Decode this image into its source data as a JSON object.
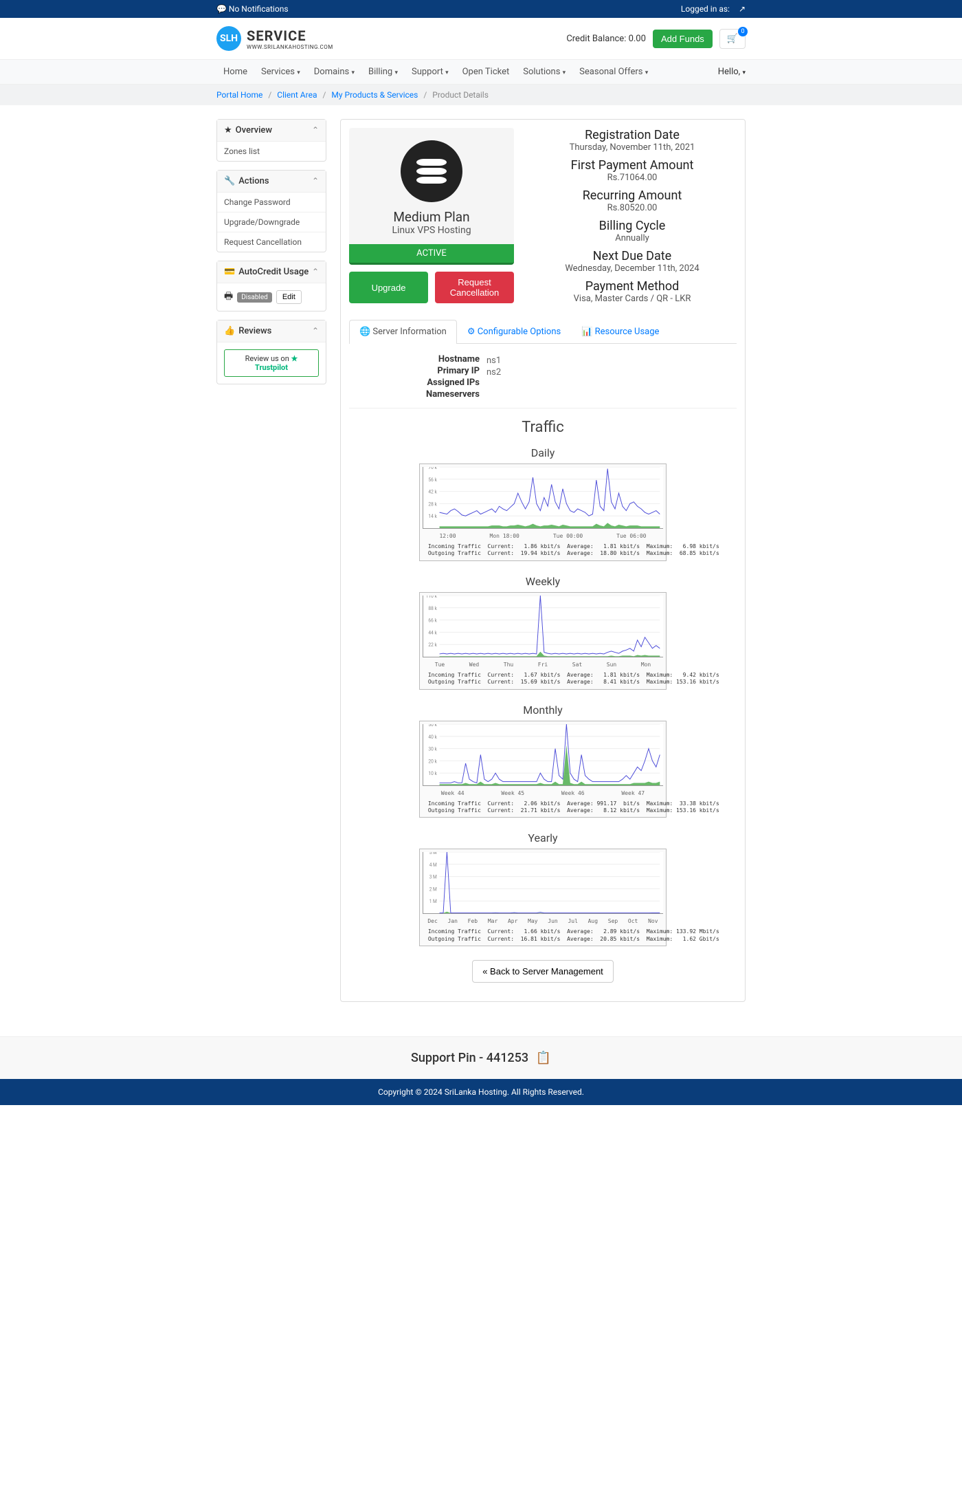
{
  "topbar": {
    "notifications": "No Notifications",
    "logged_in": "Logged in as:",
    "user": "        "
  },
  "header": {
    "logo_main": "SERVICE",
    "logo_sub": "WWW.SRILANKAHOSTING.COM",
    "logo_badge": "SLH",
    "credit_label": "Credit Balance: 0.00",
    "add_funds": "Add Funds",
    "cart_count": "0"
  },
  "nav": {
    "items": [
      "Home",
      "Services",
      "Domains",
      "Billing",
      "Support",
      "Open Ticket",
      "Solutions",
      "Seasonal Offers"
    ],
    "dropdowns": [
      false,
      true,
      true,
      true,
      true,
      false,
      true,
      true
    ],
    "hello": "Hello,",
    "hello_user": "  "
  },
  "breadcrumb": {
    "portal": "Portal Home",
    "client": "Client Area",
    "products": "My Products & Services",
    "current": "Product Details"
  },
  "sidebar": {
    "overview": {
      "title": "Overview",
      "items": [
        "Zones list"
      ]
    },
    "actions": {
      "title": "Actions",
      "items": [
        "Change Password",
        "Upgrade/Downgrade",
        "Request Cancellation"
      ]
    },
    "autocredit": {
      "title": "AutoCredit Usage",
      "status": "Disabled",
      "edit": "Edit"
    },
    "reviews": {
      "title": "Reviews",
      "trustpilot": "Review us on ★ Trustpilot"
    }
  },
  "product": {
    "plan": "Medium Plan",
    "subtitle": "Linux VPS Hosting",
    "status": "ACTIVE",
    "upgrade": "Upgrade",
    "cancel": "Request Cancellation",
    "info": [
      {
        "label": "Registration Date",
        "value": "Thursday, November 11th, 2021"
      },
      {
        "label": "First Payment Amount",
        "value": "Rs.71064.00"
      },
      {
        "label": "Recurring Amount",
        "value": "Rs.80520.00"
      },
      {
        "label": "Billing Cycle",
        "value": "Annually"
      },
      {
        "label": "Next Due Date",
        "value": "Wednesday, December 11th, 2024"
      },
      {
        "label": "Payment Method",
        "value": "Visa, Master Cards / QR - LKR"
      }
    ]
  },
  "tabs": {
    "server": "Server Information",
    "config": "Configurable Options",
    "resource": "Resource Usage"
  },
  "server": {
    "hostname_label": "Hostname",
    "hostname": "           ",
    "ip_label": "Primary IP",
    "ip": "           ",
    "assigned_label": "Assigned IPs",
    "assigned": "                                           ",
    "ns_label": "Nameservers",
    "ns1": "ns1",
    "ns2": "ns2"
  },
  "traffic": {
    "title": "Traffic",
    "charts": [
      "Daily",
      "Weekly",
      "Monthly",
      "Yearly"
    ]
  },
  "chart_data": [
    {
      "type": "line",
      "title": "Daily",
      "ylim": [
        0,
        70
      ],
      "yunit": "k",
      "ticks": [
        "12:00",
        "Mon 18:00",
        "Tue 00:00",
        "Tue 06:00"
      ],
      "series": [
        {
          "name": "Incoming Traffic",
          "color": "#2a9d2a",
          "stats": {
            "Current": "1.86 kbit/s",
            "Average": "1.81 kbit/s",
            "Maximum": "6.98 kbit/s"
          }
        },
        {
          "name": "Outgoing Traffic",
          "color": "#4a4ad8",
          "stats": {
            "Current": "19.94 kbit/s",
            "Average": "18.80 kbit/s",
            "Maximum": "68.85 kbit/s"
          }
        }
      ],
      "out_values": [
        18,
        17,
        16,
        20,
        22,
        19,
        15,
        14,
        16,
        18,
        20,
        16,
        18,
        20,
        22,
        18,
        25,
        22,
        20,
        24,
        28,
        40,
        30,
        22,
        30,
        58,
        28,
        20,
        35,
        25,
        50,
        30,
        22,
        45,
        28,
        20,
        18,
        22,
        20,
        18,
        14,
        16,
        55,
        25,
        20,
        68,
        30,
        22,
        40,
        25,
        20,
        28,
        30,
        25,
        22,
        18,
        16,
        18,
        20,
        16
      ],
      "in_values": [
        2,
        2,
        2,
        2,
        2,
        2,
        2,
        2,
        2,
        2,
        2,
        2,
        2,
        2,
        3,
        3,
        3,
        2,
        2,
        3,
        3,
        4,
        3,
        2,
        3,
        5,
        3,
        2,
        3,
        3,
        4,
        3,
        2,
        4,
        3,
        2,
        2,
        2,
        2,
        2,
        2,
        2,
        5,
        3,
        2,
        6,
        3,
        2,
        4,
        3,
        2,
        3,
        3,
        3,
        2,
        2,
        2,
        2,
        2,
        2
      ]
    },
    {
      "type": "line",
      "title": "Weekly",
      "ylim": [
        0,
        110
      ],
      "yunit": "k",
      "ticks": [
        "Tue",
        "Wed",
        "Thu",
        "Fri",
        "Sat",
        "Sun",
        "Mon"
      ],
      "series": [
        {
          "name": "Incoming Traffic",
          "color": "#2a9d2a",
          "stats": {
            "Current": "1.67 kbit/s",
            "Average": "1.81 kbit/s",
            "Maximum": "9.42 kbit/s"
          }
        },
        {
          "name": "Outgoing Traffic",
          "color": "#4a4ad8",
          "stats": {
            "Current": "15.69 kbit/s",
            "Average": "8.41 kbit/s",
            "Maximum": "153.16 kbit/s"
          }
        }
      ],
      "out_values": [
        5,
        6,
        5,
        6,
        5,
        6,
        5,
        6,
        5,
        6,
        5,
        6,
        5,
        6,
        5,
        6,
        5,
        6,
        5,
        6,
        5,
        6,
        5,
        6,
        5,
        6,
        5,
        110,
        8,
        6,
        5,
        6,
        5,
        6,
        5,
        6,
        5,
        6,
        5,
        6,
        5,
        6,
        5,
        6,
        5,
        8,
        10,
        8,
        6,
        10,
        12,
        15,
        10,
        30,
        18,
        35,
        25,
        15,
        20,
        15
      ],
      "in_values": [
        1,
        1,
        1,
        1,
        1,
        1,
        1,
        1,
        1,
        1,
        1,
        1,
        1,
        1,
        1,
        1,
        1,
        1,
        1,
        1,
        1,
        1,
        1,
        1,
        1,
        1,
        1,
        9,
        2,
        1,
        1,
        1,
        1,
        1,
        1,
        1,
        1,
        1,
        1,
        1,
        1,
        1,
        1,
        1,
        1,
        1,
        2,
        1,
        1,
        2,
        2,
        2,
        1,
        3,
        2,
        3,
        2,
        2,
        2,
        2
      ]
    },
    {
      "type": "line",
      "title": "Monthly",
      "ylim": [
        0,
        50
      ],
      "yunit": "k",
      "ticks": [
        "Week 44",
        "Week 45",
        "Week 46",
        "Week 47"
      ],
      "series": [
        {
          "name": "Incoming Traffic",
          "color": "#2a9d2a",
          "stats": {
            "Current": "2.06 kbit/s",
            "Average": "991.17  bit/s",
            "Maximum": "33.38 kbit/s"
          }
        },
        {
          "name": "Outgoing Traffic",
          "color": "#4a4ad8",
          "stats": {
            "Current": "21.71 kbit/s",
            "Average": "8.12 kbit/s",
            "Maximum": "153.16 kbit/s"
          }
        }
      ],
      "out_values": [
        2,
        2,
        2,
        2,
        3,
        2,
        2,
        18,
        5,
        3,
        2,
        25,
        5,
        3,
        5,
        10,
        5,
        3,
        3,
        3,
        3,
        3,
        3,
        3,
        3,
        3,
        3,
        10,
        5,
        3,
        3,
        30,
        8,
        5,
        50,
        10,
        5,
        3,
        25,
        8,
        5,
        3,
        3,
        3,
        3,
        3,
        3,
        3,
        3,
        5,
        8,
        5,
        10,
        15,
        12,
        20,
        30,
        20,
        15,
        25
      ],
      "in_values": [
        1,
        1,
        1,
        1,
        1,
        1,
        1,
        2,
        1,
        1,
        1,
        3,
        1,
        1,
        1,
        2,
        1,
        1,
        1,
        1,
        1,
        1,
        1,
        1,
        1,
        1,
        1,
        2,
        1,
        1,
        1,
        3,
        1,
        1,
        33,
        2,
        1,
        1,
        3,
        1,
        1,
        1,
        1,
        1,
        1,
        1,
        1,
        1,
        1,
        1,
        1,
        1,
        2,
        2,
        2,
        2,
        3,
        2,
        2,
        3
      ]
    },
    {
      "type": "line",
      "title": "Yearly",
      "ylim": [
        0,
        5
      ],
      "yunit": "M",
      "ticks": [
        "Dec",
        "Jan",
        "Feb",
        "Mar",
        "Apr",
        "May",
        "Jun",
        "Jul",
        "Aug",
        "Sep",
        "Oct",
        "Nov"
      ],
      "series": [
        {
          "name": "Incoming Traffic",
          "color": "#2a9d2a",
          "stats": {
            "Current": "1.66 kbit/s",
            "Average": "2.89 kbit/s",
            "Maximum": "133.92 Mbit/s"
          }
        },
        {
          "name": "Outgoing Traffic",
          "color": "#4a4ad8",
          "stats": {
            "Current": "16.81 kbit/s",
            "Average": "20.85 kbit/s",
            "Maximum": "1.62 Gbit/s"
          }
        }
      ],
      "out_values": [
        0.02,
        0.02,
        5,
        0.02,
        0.02,
        0.02,
        0.02,
        0.02,
        0.02,
        0.02,
        0.02,
        0.02,
        0.02,
        0.02,
        0.02,
        0.04,
        0.02,
        0.02,
        0.02,
        0.02,
        0.05,
        0.02,
        0.02,
        0.02,
        0.02,
        0.02,
        0.02,
        0.08,
        0.02,
        0.02,
        0.02,
        0.02,
        0.02,
        0.02,
        0.02,
        0.02,
        0.02,
        0.02,
        0.02,
        0.02,
        0.02,
        0.02,
        0.02,
        0.02,
        0.02,
        0.02,
        0.02,
        0.02,
        0.02,
        0.02,
        0.02,
        0.02,
        0.02,
        0.02,
        0.02,
        0.02,
        0.02,
        0.03,
        0.03,
        0.03
      ],
      "in_values": [
        0.01,
        0.01,
        0.13,
        0.01,
        0.01,
        0.01,
        0.01,
        0.01,
        0.01,
        0.01,
        0.01,
        0.01,
        0.01,
        0.01,
        0.01,
        0.01,
        0.01,
        0.01,
        0.01,
        0.01,
        0.01,
        0.01,
        0.01,
        0.01,
        0.01,
        0.01,
        0.01,
        0.01,
        0.01,
        0.01,
        0.01,
        0.01,
        0.01,
        0.01,
        0.01,
        0.01,
        0.01,
        0.01,
        0.01,
        0.01,
        0.01,
        0.01,
        0.01,
        0.01,
        0.01,
        0.01,
        0.01,
        0.01,
        0.01,
        0.01,
        0.01,
        0.01,
        0.01,
        0.01,
        0.01,
        0.01,
        0.01,
        0.01,
        0.01,
        0.01
      ]
    }
  ],
  "back_btn": "« Back to Server Management",
  "support_pin": "Support Pin - 441253",
  "footer": "Copyright © 2024 SriLanka Hosting. All Rights Reserved."
}
